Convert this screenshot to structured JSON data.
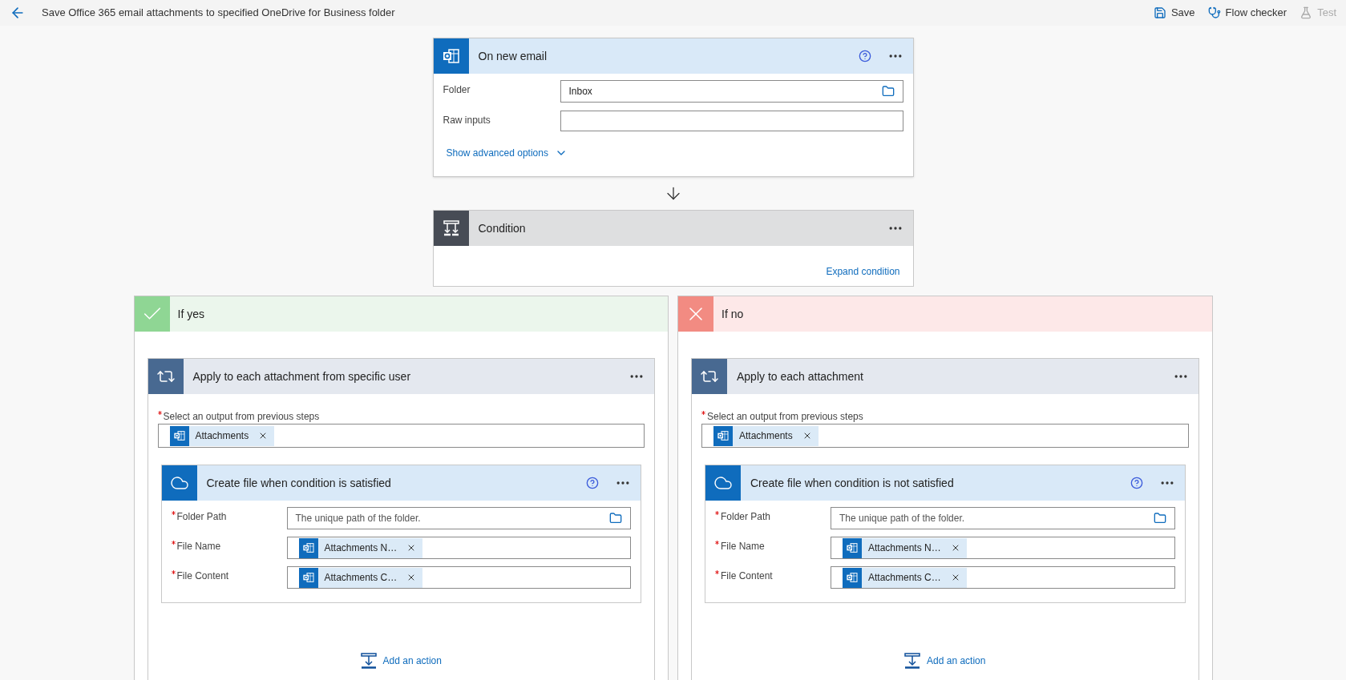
{
  "header": {
    "title": "Save Office 365 email attachments to specified OneDrive for Business folder",
    "actions": [
      {
        "kind": "save",
        "label": "Save",
        "disabled": false
      },
      {
        "kind": "checker",
        "label": "Flow checker",
        "disabled": false
      },
      {
        "kind": "test",
        "label": "Test",
        "disabled": true
      }
    ]
  },
  "trigger": {
    "title": "On new email",
    "fields": [
      {
        "kind": "folder",
        "label": "Folder",
        "value": "Inbox"
      },
      {
        "kind": "text",
        "label": "Raw inputs"
      }
    ],
    "advanced_link": "Show advanced options"
  },
  "condition": {
    "title": "Condition",
    "link": "Expand condition"
  },
  "branches": [
    {
      "kind": "yes",
      "title": "If yes",
      "loop": {
        "title": "Apply to each attachment from specific user",
        "select_label": "Select an output from previous steps",
        "required": true,
        "tokens": [
          "Attachments"
        ],
        "action": {
          "title": "Create file when condition is satisfied",
          "fields": [
            {
              "kind": "folder",
              "label": "Folder Path",
              "required": true,
              "placeholder": "The unique path of the folder."
            },
            {
              "kind": "tokens",
              "label": "File Name",
              "required": true,
              "tokens": [
                "Attachments N…"
              ]
            },
            {
              "kind": "tokens",
              "label": "File Content",
              "required": true,
              "tokens": [
                "Attachments C…"
              ]
            }
          ]
        },
        "add_action": "Add an action"
      }
    },
    {
      "kind": "no",
      "title": "If no",
      "loop": {
        "title": "Apply to each attachment",
        "select_label": "Select an output from previous steps",
        "required": true,
        "tokens": [
          "Attachments"
        ],
        "action": {
          "title": "Create file when condition is not satisfied",
          "fields": [
            {
              "kind": "folder",
              "label": "Folder Path",
              "required": true,
              "placeholder": "The unique path of the folder."
            },
            {
              "kind": "tokens",
              "label": "File Name",
              "required": true,
              "tokens": [
                "Attachments N…"
              ]
            },
            {
              "kind": "tokens",
              "label": "File Content",
              "required": true,
              "tokens": [
                "Attachments C…"
              ]
            }
          ]
        },
        "add_action": "Add an action"
      }
    }
  ]
}
